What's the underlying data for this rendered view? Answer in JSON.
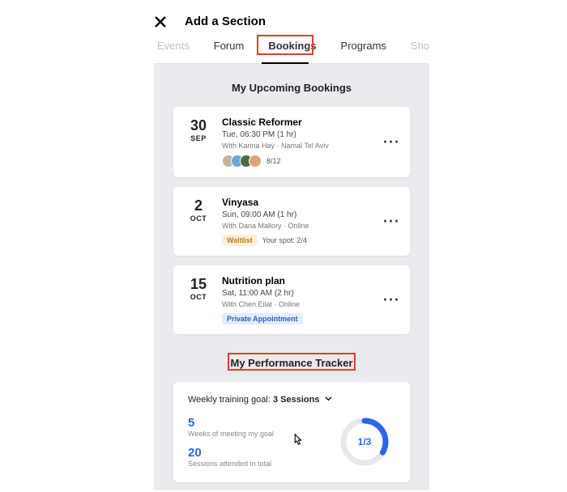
{
  "header": {
    "title": "Add a Section"
  },
  "tabs": {
    "items": [
      "Events",
      "Forum",
      "Bookings",
      "Programs",
      "Sho"
    ],
    "active": "Bookings"
  },
  "upcoming": {
    "heading": "My Upcoming Bookings",
    "cards": [
      {
        "day": "30",
        "month": "SEP",
        "title": "Classic Reformer",
        "meta": "Tue, 06:30 PM (1 hr)",
        "loc": "With Karina Hay · Namal Tel Aviv",
        "spot": "8/12"
      },
      {
        "day": "2",
        "month": "OCT",
        "title": "Vinyasa",
        "meta": "Sun, 09:00 AM (1 hr)",
        "loc": "With Dana Mallory · Online",
        "badge": "Waitlist",
        "spot_label": "Your spot: 2/4"
      },
      {
        "day": "15",
        "month": "OCT",
        "title": "Nutrition plan",
        "meta": "Sat, 11:00 AM (2 hr)",
        "loc": "With Chen Eilat · Online",
        "private": "Private Appointment"
      }
    ]
  },
  "tracker": {
    "heading": "My Performance Tracker",
    "goal_prefix": "Weekly training goal: ",
    "goal_value": "3 Sessions",
    "weeks": "5",
    "weeks_label": "Weeks of meeting my goal",
    "sessions": "20",
    "sessions_label": "Sessions attended in total",
    "progress_text": "1/3"
  }
}
